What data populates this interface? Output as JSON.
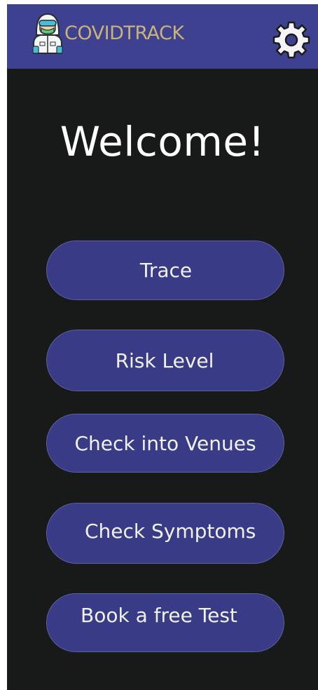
{
  "header": {
    "title": "COVIDTRACK",
    "logo_icon": "hazmat-doctor-icon",
    "settings_icon": "gear-icon",
    "accent_color": "#3d418f",
    "title_color": "#c9b27a"
  },
  "main": {
    "welcome": "Welcome!",
    "buttons": [
      {
        "label": "Trace"
      },
      {
        "label": "Risk Level"
      },
      {
        "label": "Check into Venues"
      },
      {
        "label": "Check Symptoms"
      },
      {
        "label": "Book a free Test"
      }
    ],
    "button_color": "#393b86",
    "background_color": "#181a1a"
  }
}
